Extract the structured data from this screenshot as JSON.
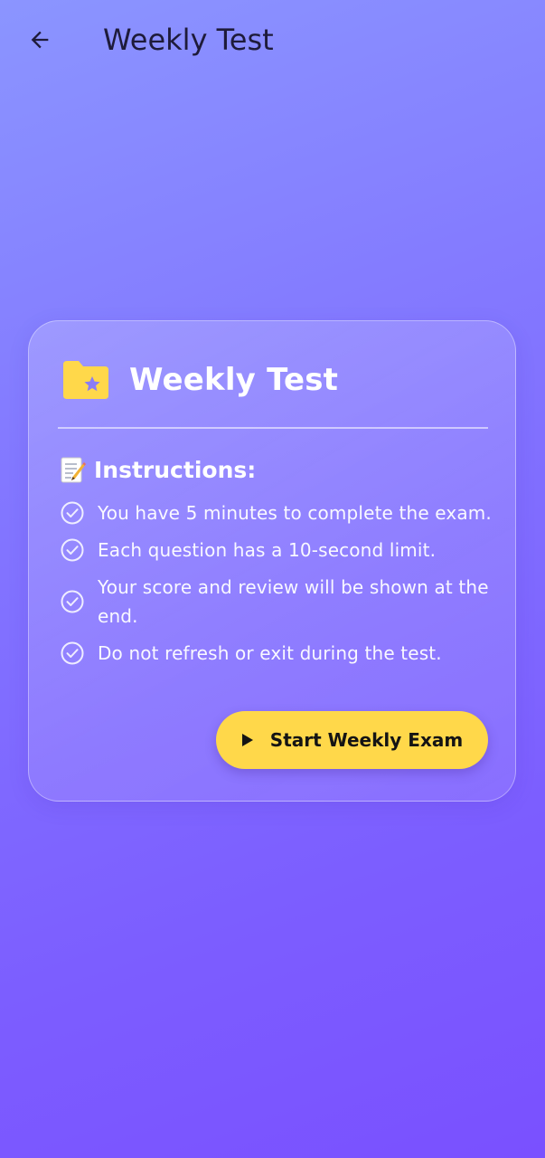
{
  "app_bar": {
    "title": "Weekly Test",
    "back_icon": "arrow-left-icon"
  },
  "card": {
    "icon": "folder-star-icon",
    "title": "Weekly Test",
    "instructions_emoji": "memo-icon",
    "instructions_label": "Instructions:",
    "instructions": [
      "You have 5 minutes to complete the exam.",
      "Each question has a 10-second limit.",
      "Your score and review will be shown at the end.",
      "Do not refresh or exit during the test."
    ],
    "start_button": {
      "icon": "play-icon",
      "label": "Start Weekly Exam"
    }
  },
  "colors": {
    "gradient_top": "#8b95ff",
    "gradient_bottom": "#7a50ff",
    "accent_yellow": "#ffd84a",
    "text_dark": "#1e1b3a"
  }
}
